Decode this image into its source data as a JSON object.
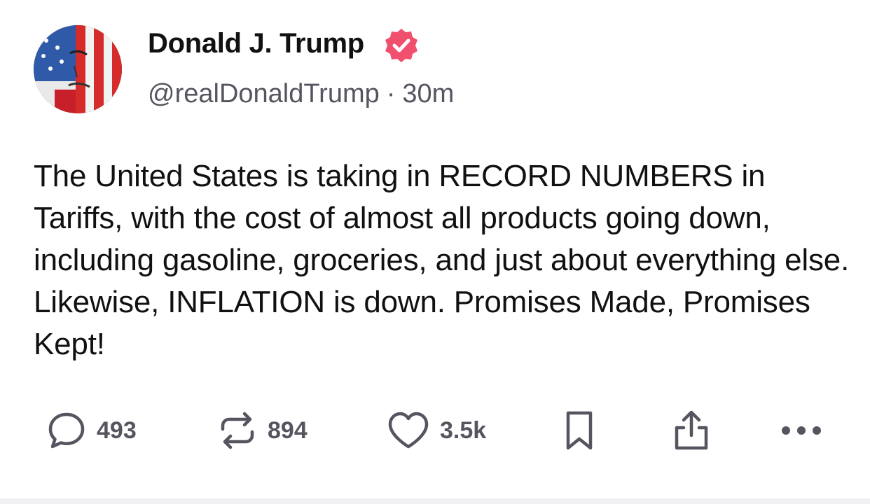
{
  "author": {
    "display_name": "Donald J. Trump",
    "handle": "@realDonaldTrump",
    "separator": "·",
    "time_ago": "30m",
    "verified_badge_color": "#f0506e"
  },
  "post": {
    "text": "The United States is taking in RECORD NUMBERS in Tariffs, with the cost of almost all products going down, including gasoline, groceries, and just about everything else. Likewise, INFLATION is down. Promises Made, Promises Kept!"
  },
  "actions": {
    "reply": {
      "icon": "reply-icon",
      "count": "493"
    },
    "repost": {
      "icon": "repost-icon",
      "count": "894"
    },
    "like": {
      "icon": "heart-icon",
      "count": "3.5k"
    },
    "bookmark": {
      "icon": "bookmark-icon"
    },
    "share": {
      "icon": "share-icon"
    },
    "more": {
      "icon": "more-icon"
    }
  },
  "colors": {
    "text_primary": "#111111",
    "text_secondary": "#555560",
    "icon_gray": "#55555f"
  }
}
